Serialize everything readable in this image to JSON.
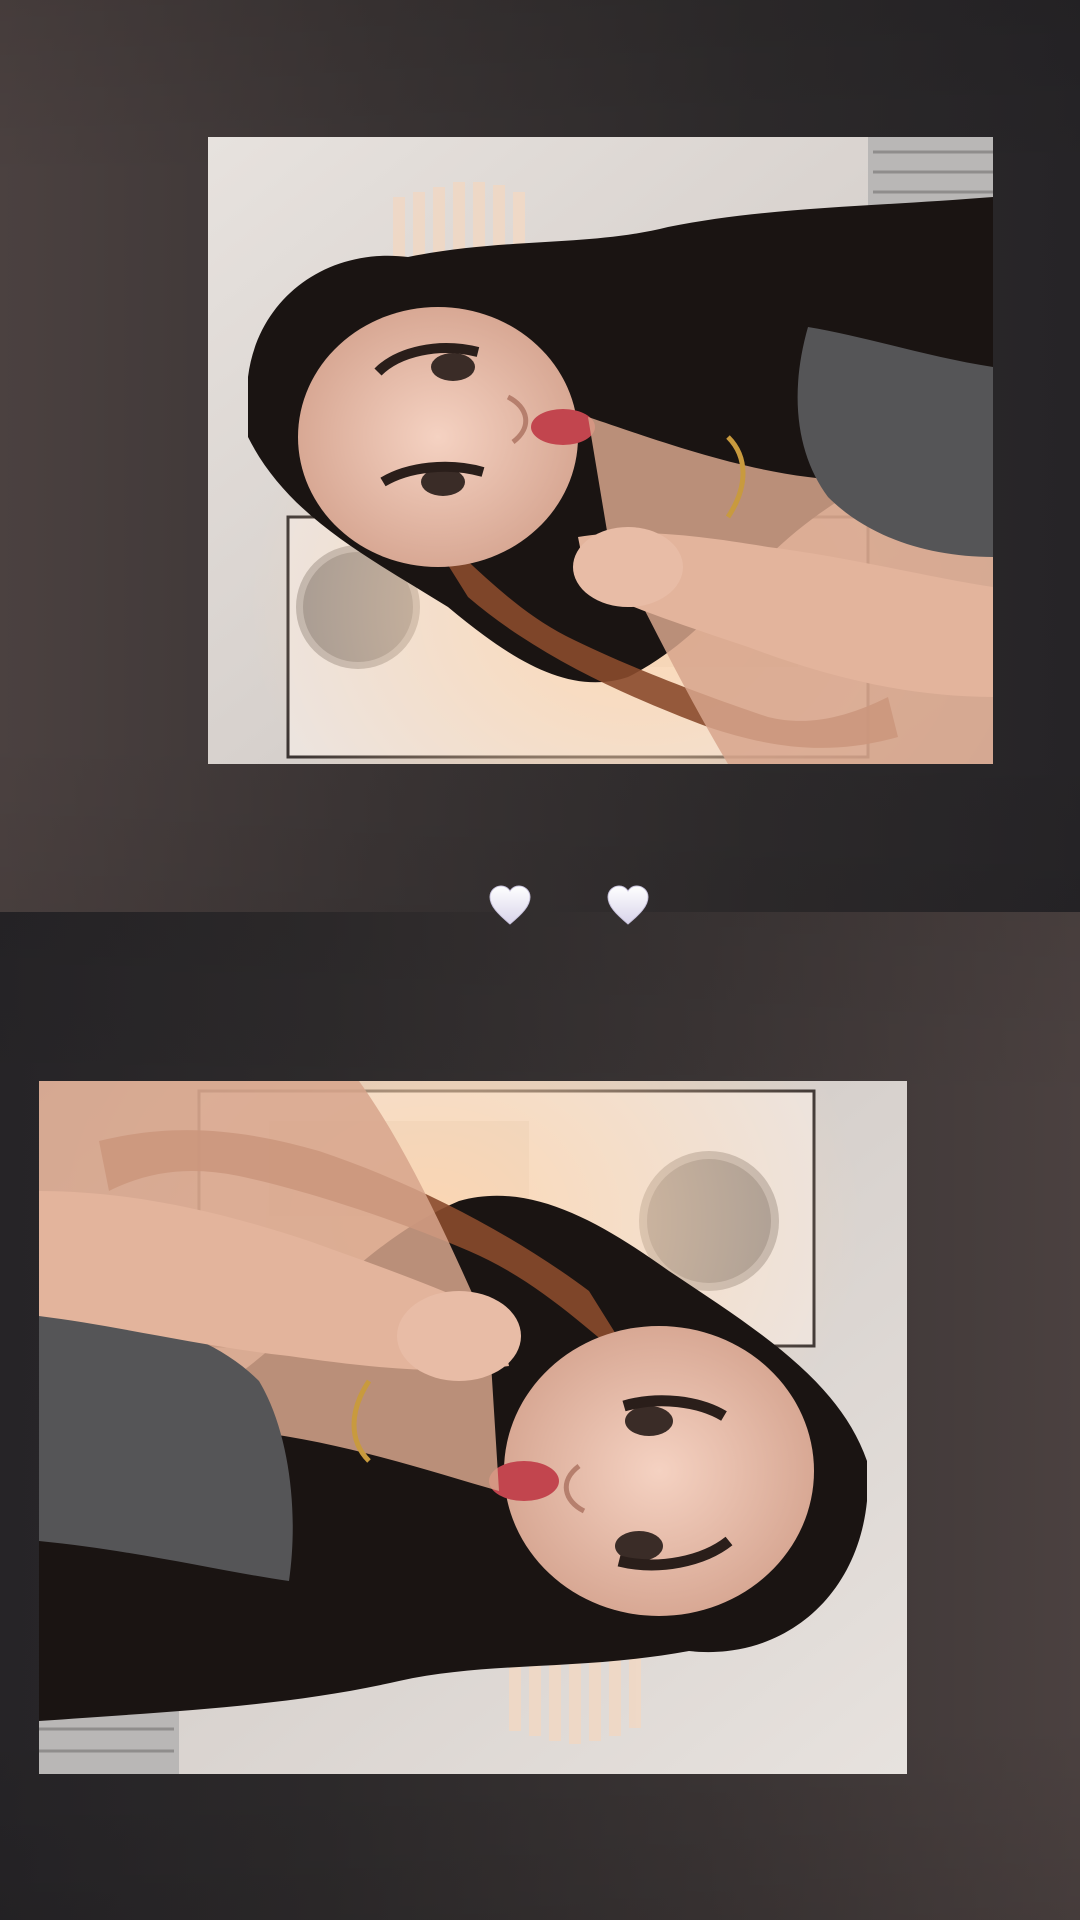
{
  "story": {
    "background_colors": {
      "light": "#4b4140",
      "dark": "#262427"
    },
    "photos": [
      {
        "orientation": "rotated-counterclockwise",
        "depicts": "portrait-photo"
      },
      {
        "orientation": "rotated-clockwise",
        "depicts": "portrait-photo"
      }
    ],
    "stickers": [
      {
        "icon": "white-heart-icon",
        "color": "#f3f0fb"
      },
      {
        "icon": "white-heart-icon",
        "color": "#f3f0fb"
      }
    ]
  }
}
